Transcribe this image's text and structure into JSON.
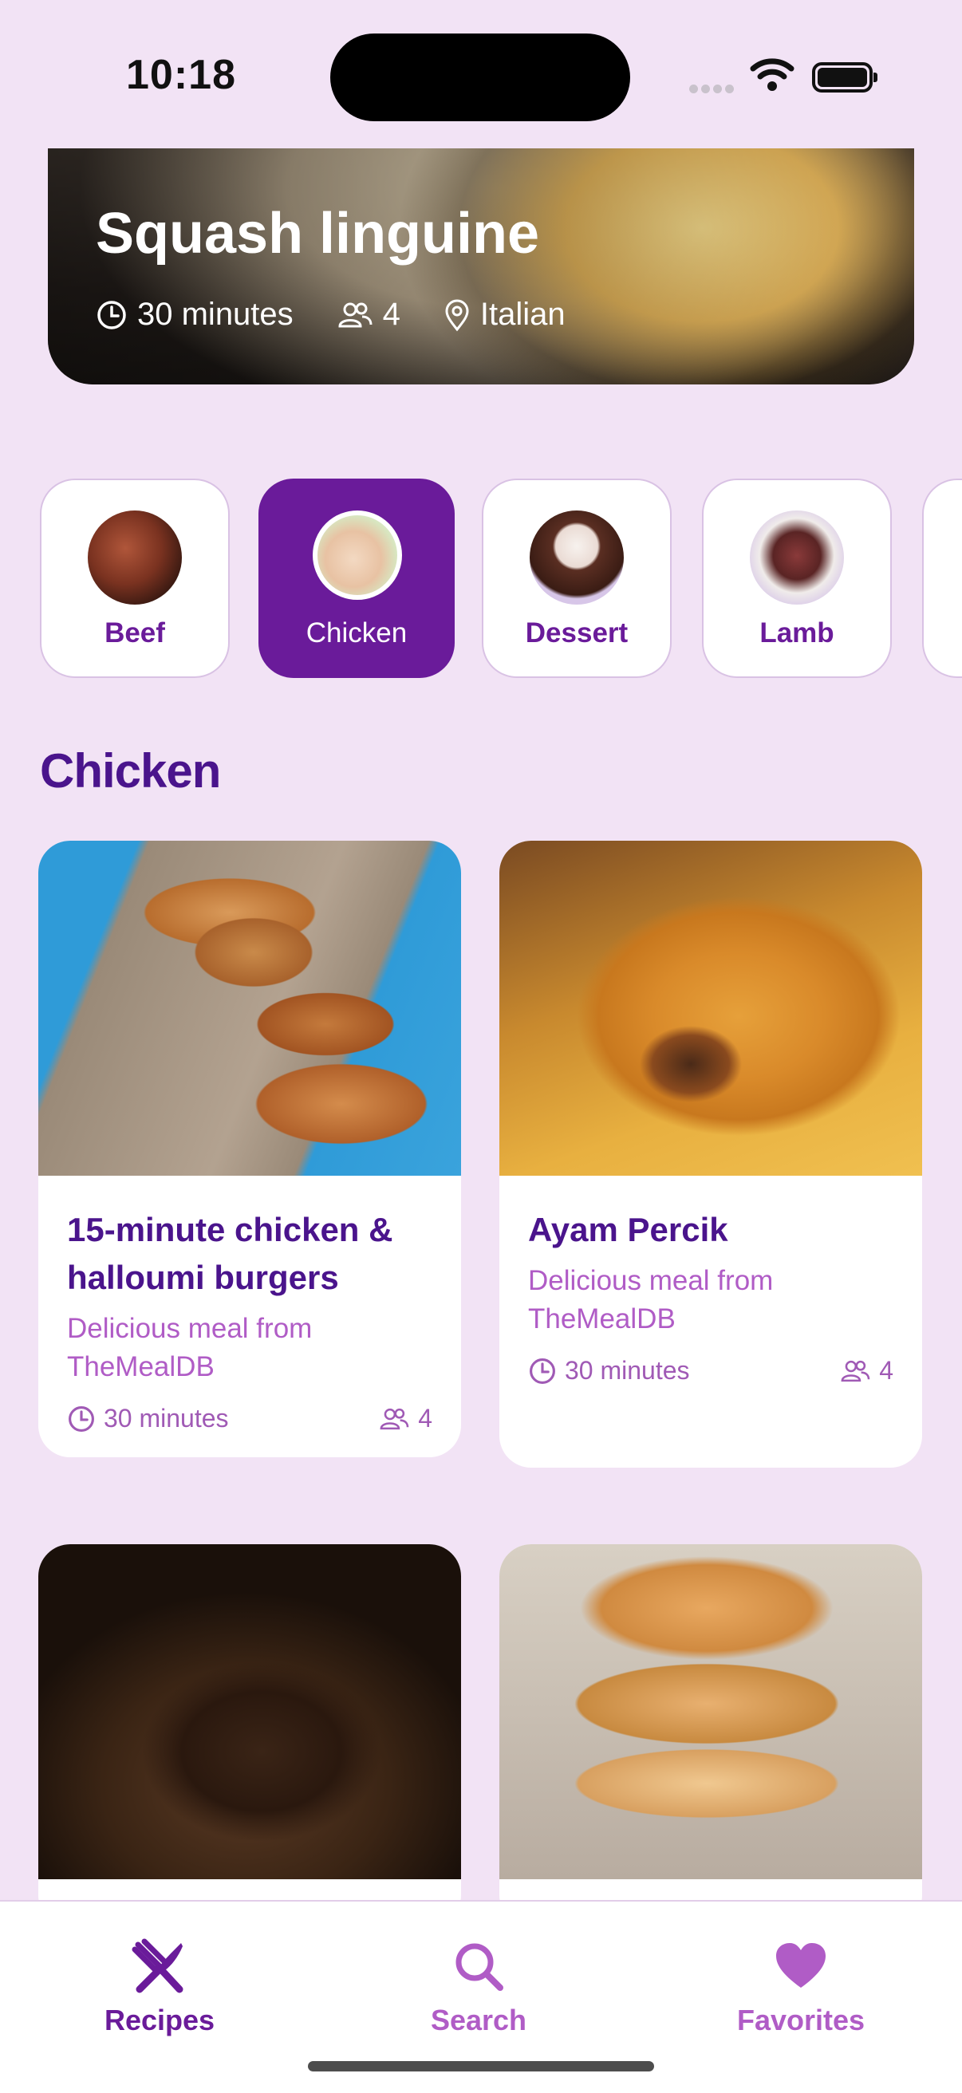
{
  "status_bar": {
    "time": "10:18"
  },
  "hero": {
    "title": "Squash linguine",
    "time": "30 minutes",
    "servings": "4",
    "cuisine": "Italian"
  },
  "categories": [
    {
      "label": "Beef"
    },
    {
      "label": "Chicken"
    },
    {
      "label": "Dessert"
    },
    {
      "label": "Lamb"
    }
  ],
  "selected_category": "Chicken",
  "section": {
    "title": "Chicken"
  },
  "recipes": [
    {
      "title": "15-minute chicken & halloumi burgers",
      "subtitle": "Delicious meal from TheMealDB",
      "time": "30 minutes",
      "servings": "4"
    },
    {
      "title": "Ayam Percik",
      "subtitle": "Delicious meal from TheMealDB",
      "time": "30 minutes",
      "servings": "4"
    }
  ],
  "tabbar": {
    "items": [
      {
        "label": "Recipes",
        "icon": "fork-knife-icon"
      },
      {
        "label": "Search",
        "icon": "search-icon"
      },
      {
        "label": "Favorites",
        "icon": "heart-icon"
      }
    ],
    "active": "Recipes"
  },
  "colors": {
    "primary": "#6a1b9a",
    "heading": "#4a148c",
    "accent_light": "#b05cc6",
    "background": "#f2e3f5"
  }
}
